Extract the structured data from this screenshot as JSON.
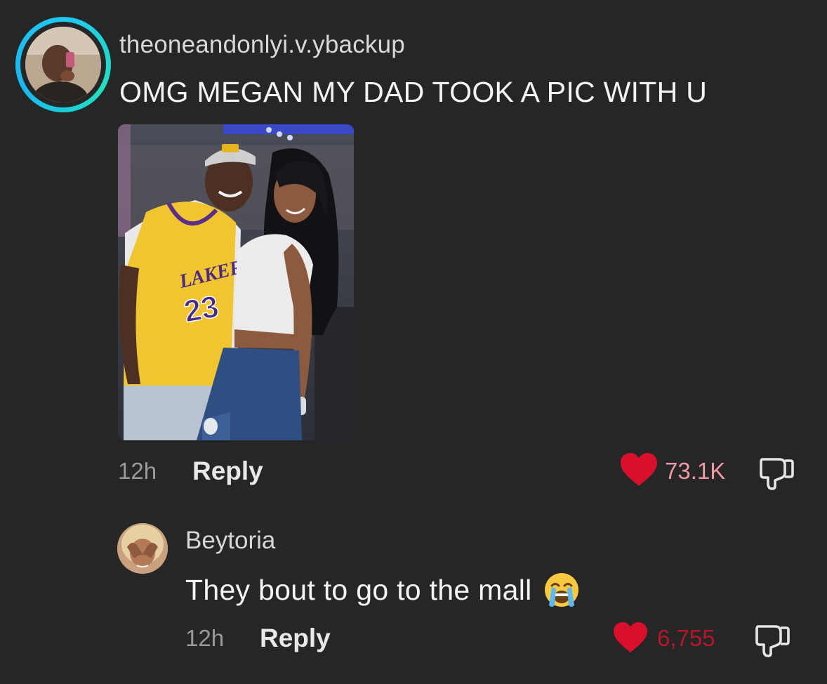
{
  "comment": {
    "username": "theoneandonlyi.v.ybackup",
    "text": "OMG MEGAN MY DAD TOOK A PIC WITH U",
    "time": "12h",
    "reply_label": "Reply",
    "likes": "73.1K",
    "photo": {
      "jersey_team": "LAKERS",
      "jersey_number": "23"
    }
  },
  "reply": {
    "username": "Beytoria",
    "text": "They bout to go to the mall",
    "emoji": "loudly-crying-face",
    "time": "12h",
    "reply_label": "Reply",
    "likes": "6,755"
  },
  "colors": {
    "background": "#262626",
    "heart": "#d8102c",
    "like_count_top": "#ee9aa4",
    "like_count_reply": "#b8152b",
    "avatar_ring": "#1ec8f0"
  }
}
